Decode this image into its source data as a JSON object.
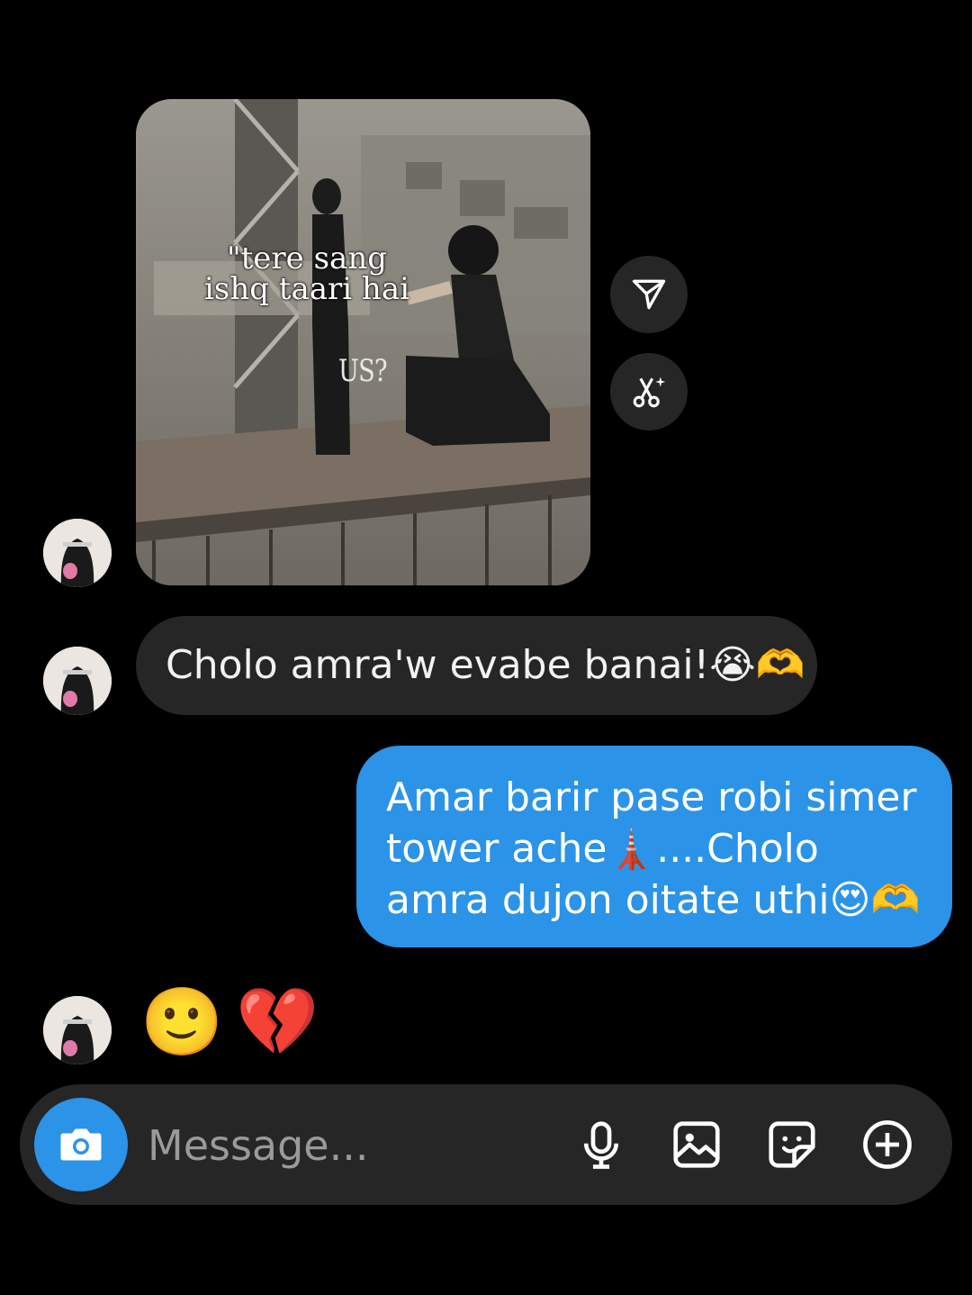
{
  "media": {
    "overlay_caption": "\"tere sang ishq taari hai",
    "inline_label": "US?"
  },
  "messages": {
    "incoming_text": "Cholo amra'w evabe banai!😭🫶",
    "outgoing_text": "Amar barir pase robi simer tower ache🗼....Cholo amra dujon oitate uthi😍🫶",
    "reaction_emojis": [
      "🙂",
      "💔"
    ]
  },
  "actions": {
    "share_icon": "send-icon",
    "clip_icon": "scissors-sparkle-icon"
  },
  "composer": {
    "placeholder": "Message...",
    "icons": [
      "camera-icon",
      "microphone-icon",
      "gallery-icon",
      "sticker-icon",
      "add-icon"
    ]
  },
  "colors": {
    "background": "#000000",
    "incoming_bubble": "#262626",
    "outgoing_bubble": "#2b93e8",
    "accent": "#2b93e8"
  }
}
